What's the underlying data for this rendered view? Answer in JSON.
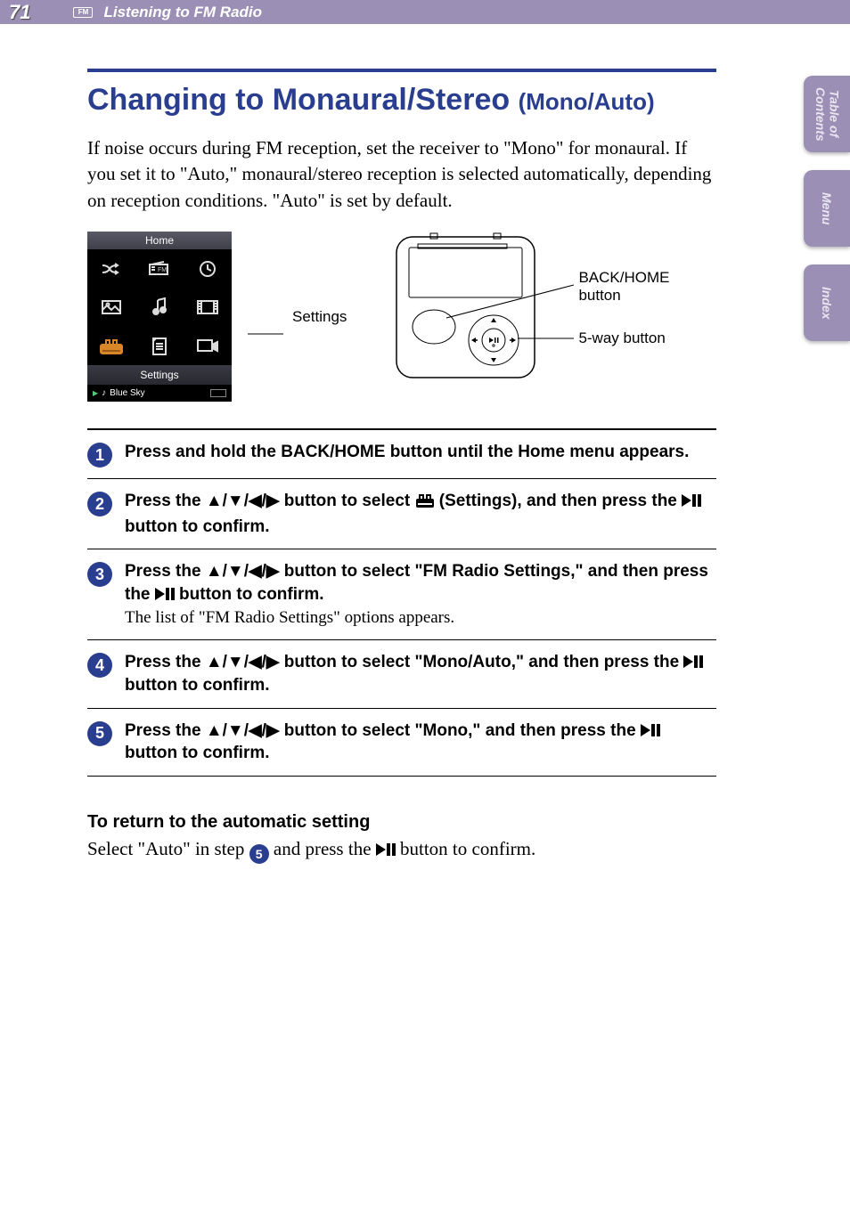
{
  "header": {
    "page_number": "71",
    "chapter": "Listening to FM Radio"
  },
  "side_tabs": [
    {
      "label": "Table of\nContents"
    },
    {
      "label": "Menu"
    },
    {
      "label": "Index"
    }
  ],
  "title_main": "Changing to Monaural/Stereo ",
  "title_paren": "(Mono/Auto)",
  "intro": "If noise occurs during FM reception, set the receiver to \"Mono\" for monaural. If you set it to \"Auto,\" monaural/stereo reception is selected automatically, depending on reception conditions. \"Auto\" is set by default.",
  "device_screen": {
    "home_label": "Home",
    "settings_label": "Settings",
    "now_playing": "Blue Sky"
  },
  "figure_labels": {
    "settings": "Settings",
    "back_home": "BACK/HOME button",
    "five_way": "5-way button"
  },
  "steps": [
    {
      "num": "1",
      "bold": "Press and hold the BACK/HOME button until the Home menu appears."
    },
    {
      "num": "2",
      "bold_pre": "Press the ",
      "arrows": "▲/▼/◀/▶",
      "bold_mid": " button to select ",
      "icon_after": " (Settings), and then press the ",
      "bold_tail": " button to confirm."
    },
    {
      "num": "3",
      "bold_pre": "Press the ",
      "arrows": "▲/▼/◀/▶",
      "bold_mid": " button to select \"FM Radio Settings,\" and then press the ",
      "bold_tail": " button to confirm.",
      "reg": "The list of \"FM Radio Settings\" options appears."
    },
    {
      "num": "4",
      "bold_pre": "Press the ",
      "arrows": "▲/▼/◀/▶",
      "bold_mid": " button to select \"Mono/Auto,\" and then press the ",
      "bold_tail": " button to confirm."
    },
    {
      "num": "5",
      "bold_pre": "Press the ",
      "arrows": "▲/▼/◀/▶",
      "bold_mid": " button to select \"Mono,\" and then press the ",
      "bold_tail": " button to confirm."
    }
  ],
  "return_section": {
    "heading": "To return to the automatic setting",
    "text_pre": "Select \"Auto\" in step ",
    "badge": "5",
    "text_mid": " and press the ",
    "text_post": " button to confirm."
  }
}
